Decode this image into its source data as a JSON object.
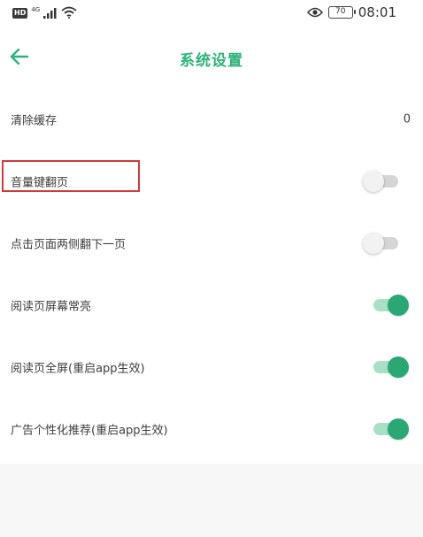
{
  "status_bar": {
    "hd_label": "HD",
    "network_label": "4G",
    "battery_level": "70",
    "time": "08:01"
  },
  "header": {
    "title": "系统设置",
    "back_icon": "arrow-left-icon"
  },
  "settings": [
    {
      "label": "清除缓存",
      "type": "value",
      "value": "0"
    },
    {
      "label": "音量键翻页",
      "type": "toggle",
      "state": "off",
      "highlighted": true
    },
    {
      "label": "点击页面两侧翻下一页",
      "type": "toggle",
      "state": "off"
    },
    {
      "label": "阅读页屏幕常亮",
      "type": "toggle",
      "state": "on"
    },
    {
      "label": "阅读页全屏(重启app生效)",
      "type": "toggle",
      "state": "on"
    },
    {
      "label": "广告个性化推荐(重启app生效)",
      "type": "toggle",
      "state": "on"
    }
  ],
  "colors": {
    "accent": "#2db37a",
    "toggle_on_knob": "#2aa874",
    "toggle_on_track": "#a8e0c5",
    "toggle_off_track": "#d5d5d5",
    "highlight": "#d03a3a"
  }
}
